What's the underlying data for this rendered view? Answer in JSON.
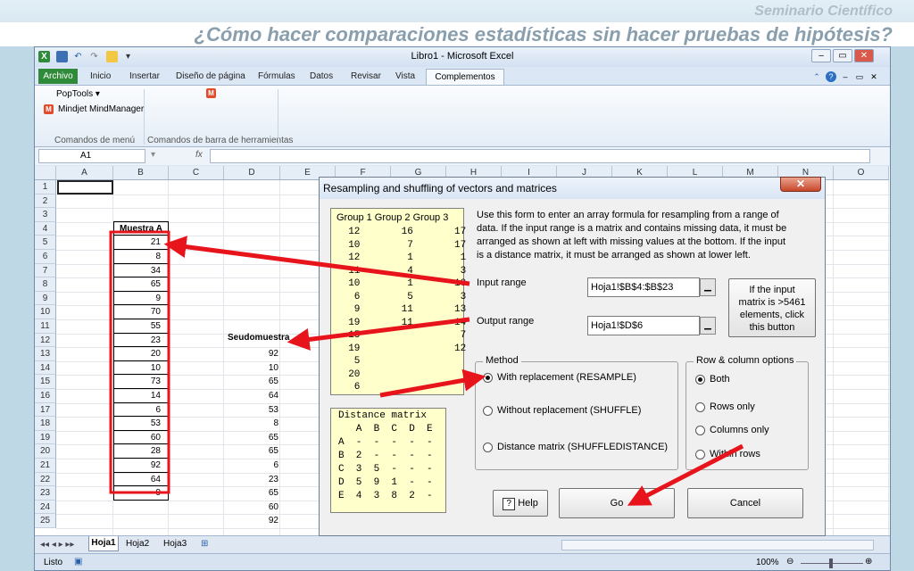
{
  "slide": {
    "header": "Seminario Científico",
    "title": "¿Cómo hacer comparaciones estadísticas sin hacer pruebas de hipótesis?"
  },
  "window": {
    "title": "Libro1 - Microsoft Excel"
  },
  "menu": {
    "file": "Archivo",
    "tabs": [
      "Inicio",
      "Insertar",
      "Diseño de página",
      "Fórmulas",
      "Datos",
      "Revisar",
      "Vista"
    ],
    "active": "Complementos"
  },
  "ribbon": {
    "poptools": "PopTools",
    "mindjet": "Mindjet MindManager",
    "group1": "Comandos de menú",
    "group2": "Comandos de barra de herramientas"
  },
  "formula": {
    "cell_ref": "A1",
    "fx": "fx"
  },
  "grid": {
    "columns": [
      "A",
      "B",
      "C",
      "D",
      "E",
      "F",
      "G",
      "H",
      "I",
      "J",
      "K",
      "L",
      "M",
      "N",
      "O"
    ],
    "rows": [
      "1",
      "2",
      "3",
      "4",
      "5",
      "6",
      "7",
      "8",
      "9",
      "10",
      "11",
      "12",
      "13",
      "14",
      "15",
      "16",
      "17",
      "18",
      "19",
      "20",
      "21",
      "22",
      "23",
      "24",
      "25"
    ],
    "muestra_header": "Muestra A",
    "muestra_values": [
      "21",
      "8",
      "34",
      "65",
      "9",
      "70",
      "55",
      "23",
      "20",
      "10",
      "73",
      "14",
      "6",
      "53",
      "60",
      "28",
      "92",
      "64",
      "9"
    ],
    "seudo_header": "Seudomuestra",
    "seudo_values": [
      "92",
      "10",
      "65",
      "64",
      "53",
      "8",
      "65",
      "65",
      "6",
      "23",
      "65",
      "60",
      "92"
    ]
  },
  "sheets": [
    "Hoja1",
    "Hoja2",
    "Hoja3"
  ],
  "status": {
    "ready": "Listo",
    "zoom": "100%"
  },
  "dialog": {
    "title": "Resampling and shuffling of vectors and matrices",
    "groups_header": "Group 1  Group 2  Group 3",
    "groups_rows": [
      "  12       16       17",
      "  10        7       17",
      "  12        1        1",
      "  11        4        3",
      "  10        1       10",
      "   6        5        3",
      "   9       11       13",
      "  19       11       14",
      "  15                 7",
      "  19                12",
      "   5",
      "  20",
      "   6"
    ],
    "distance_title": "Distance matrix",
    "distance_rows": [
      "   A  B  C  D  E",
      "A  -  -  -  -  -",
      "B  2  -  -  -  -",
      "C  3  5  -  -  -",
      "D  5  9  1  -  -",
      "E  4  3  8  2  -"
    ],
    "description": [
      "Use this form to enter an array formula for resampling from a range of",
      "data. If the input range is a matrix and contains missing data, it must be",
      "arranged as shown at left with missing values at the bottom. If the input",
      "is a distance matrix, it must be arranged as shown at lower left."
    ],
    "input_label": "Input range",
    "input_value": "Hoja1!$B$4:$B$23",
    "output_label": "Output range",
    "output_value": "Hoja1!$D$6",
    "side_button": [
      "If the input",
      "matrix is >5461",
      "elements, click",
      "this button"
    ],
    "method_legend": "Method",
    "method_options": [
      "With replacement (RESAMPLE)",
      "Without replacement (SHUFFLE)",
      "Distance matrix (SHUFFLEDISTANCE)"
    ],
    "rc_legend": "Row & column options",
    "rc_options": [
      "Both",
      "Rows only",
      "Columns only",
      "Within rows"
    ],
    "help": "Help",
    "go": "Go",
    "cancel": "Cancel"
  },
  "colors": {
    "annotation": "#e8141c",
    "excel_green": "#2f8a3a",
    "accent_title": "#8a9fae"
  }
}
